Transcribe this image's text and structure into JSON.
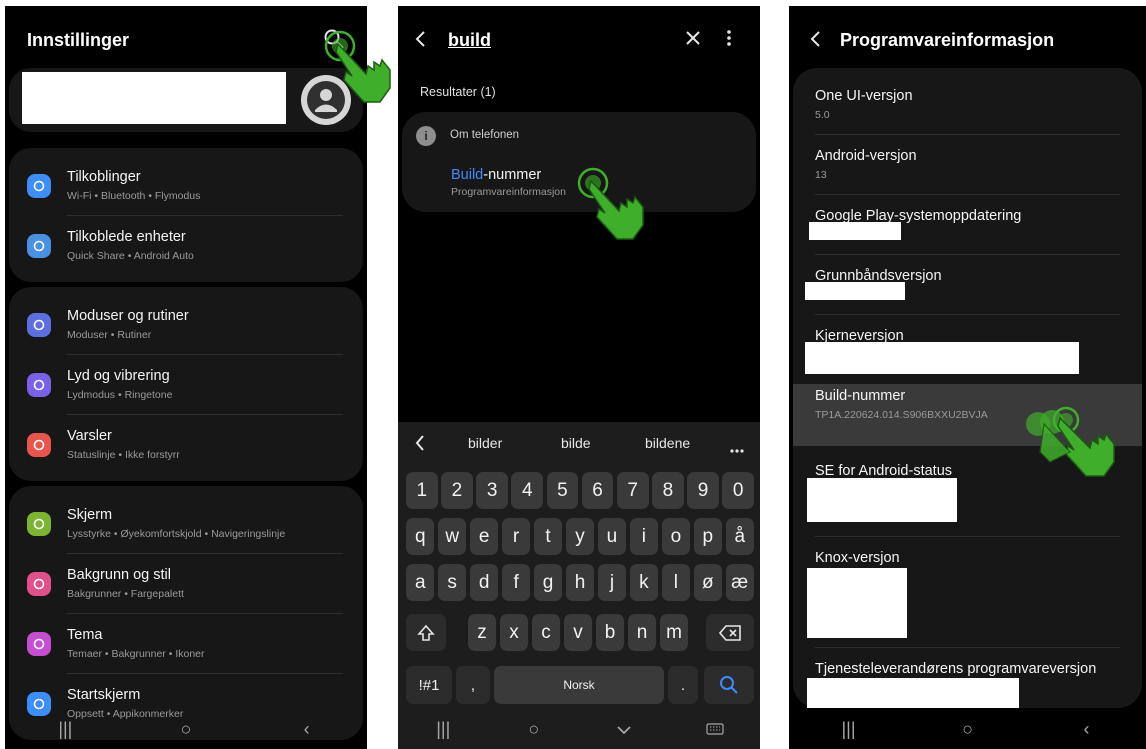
{
  "panel1": {
    "title": "Innstillinger",
    "groups": [
      [
        {
          "label": "Tilkoblinger",
          "sub": "Wi-Fi  •  Bluetooth  •  Flymodus",
          "icon": "wifi-icon",
          "color": "#3e8ef7"
        },
        {
          "label": "Tilkoblede enheter",
          "sub": "Quick Share  •  Android Auto",
          "icon": "devices-icon",
          "color": "#4a90e2"
        }
      ],
      [
        {
          "label": "Moduser og rutiner",
          "sub": "Moduser  •  Rutiner",
          "icon": "check-circle-icon",
          "color": "#5c6ee0"
        },
        {
          "label": "Lyd og vibrering",
          "sub": "Lydmodus  •  Ringetone",
          "icon": "volume-icon",
          "color": "#7b61e8"
        },
        {
          "label": "Varsler",
          "sub": "Statuslinje  •  Ikke forstyrr",
          "icon": "bell-icon",
          "color": "#e8554e"
        }
      ],
      [
        {
          "label": "Skjerm",
          "sub": "Lysstyrke  •  Øyekomfortskjold  •  Navigeringslinje",
          "icon": "sun-icon",
          "color": "#7ab431"
        },
        {
          "label": "Bakgrunn og stil",
          "sub": "Bakgrunner  •  Fargepalett",
          "icon": "image-icon",
          "color": "#e0508a"
        },
        {
          "label": "Tema",
          "sub": "Temaer  •  Bakgrunner  •  Ikoner",
          "icon": "brush-icon",
          "color": "#c54fd1"
        },
        {
          "label": "Startskjerm",
          "sub": "Oppsett  •  Appikonmerker",
          "icon": "home-icon",
          "color": "#3e8ef7"
        }
      ]
    ]
  },
  "panel2": {
    "query": "build",
    "results_label": "Resultater (1)",
    "section": "Om telefonen",
    "result_highlight": "Build",
    "result_rest": "-nummer",
    "result_sub": "Programvareinformasjon",
    "suggestions": [
      "bilder",
      "bilde",
      "bildene"
    ],
    "rows": [
      [
        "1",
        "2",
        "3",
        "4",
        "5",
        "6",
        "7",
        "8",
        "9",
        "0"
      ],
      [
        "q",
        "w",
        "e",
        "r",
        "t",
        "y",
        "u",
        "i",
        "o",
        "p",
        "å"
      ],
      [
        "a",
        "s",
        "d",
        "f",
        "g",
        "h",
        "j",
        "k",
        "l",
        "ø",
        "æ"
      ],
      [
        "z",
        "x",
        "c",
        "v",
        "b",
        "n",
        "m"
      ]
    ],
    "sym_key": "!#1",
    "comma_key": ",",
    "space_key": "Norsk",
    "period_key": "."
  },
  "panel3": {
    "title": "Programvareinformasjon",
    "items": [
      {
        "label": "One UI-versjon",
        "value": "5.0"
      },
      {
        "label": "Android-versjon",
        "value": "13"
      },
      {
        "label": "Google Play-systemoppdatering",
        "value": ""
      },
      {
        "label": "Grunnbåndsversjon",
        "value": ""
      },
      {
        "label": "Kjerneversjon",
        "value": ""
      },
      {
        "label": "Build-nummer",
        "value": "TP1A.220624.014.S906BXXU2BVJA"
      },
      {
        "label": "SE for Android-status",
        "value": ""
      },
      {
        "label": "Knox-versjon",
        "value": ""
      },
      {
        "label": "Tjenesteleverandørens programvareversjon",
        "value": ""
      }
    ]
  },
  "nav": {
    "recents": "|||",
    "home": "○",
    "back": "‹"
  },
  "colors": {
    "highlight": "#3d8bfd",
    "tap_green": "#3fae2a",
    "selected_row": "#3a3a3a"
  }
}
